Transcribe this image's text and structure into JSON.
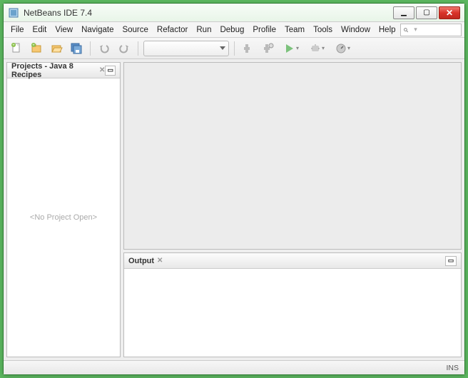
{
  "window": {
    "title": "NetBeans IDE 7.4"
  },
  "menu": {
    "items": [
      "File",
      "Edit",
      "View",
      "Navigate",
      "Source",
      "Refactor",
      "Run",
      "Debug",
      "Profile",
      "Team",
      "Tools",
      "Window",
      "Help"
    ],
    "search_placeholder": ""
  },
  "sidebar": {
    "title": "Projects - Java 8 Recipes",
    "empty_text": "<No Project Open>"
  },
  "output_panel": {
    "title": "Output"
  },
  "status": {
    "ins": "INS"
  },
  "icons": {
    "min": "▁",
    "max": "▢",
    "close": "✕",
    "search": "🔍"
  }
}
